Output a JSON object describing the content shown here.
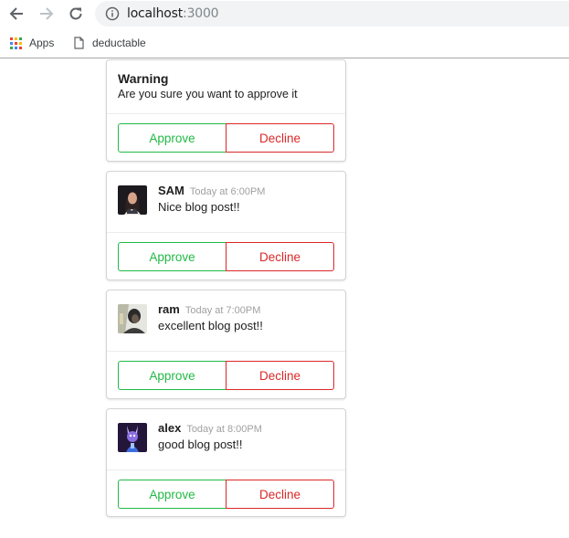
{
  "browser": {
    "url_host": "localhost",
    "url_port": ":3000",
    "bookmarks": [
      {
        "label": "Apps",
        "icon": "apps-grid-icon"
      },
      {
        "label": "deductable",
        "icon": "page-icon"
      }
    ]
  },
  "warning": {
    "title": "Warning",
    "message": "Are you sure you want to approve it",
    "approve_label": "Approve",
    "decline_label": "Decline"
  },
  "comments": [
    {
      "author": "SAM",
      "time": "Today at 6:00PM",
      "text": "Nice blog post!!",
      "approve_label": "Approve",
      "decline_label": "Decline"
    },
    {
      "author": "ram",
      "time": "Today at 7:00PM",
      "text": "excellent blog post!!",
      "approve_label": "Approve",
      "decline_label": "Decline"
    },
    {
      "author": "alex",
      "time": "Today at 8:00PM",
      "text": "good blog post!!",
      "approve_label": "Approve",
      "decline_label": "Decline"
    }
  ],
  "colors": {
    "approve": "#21ba45",
    "decline": "#db2828",
    "card_border": "#d4d4d5",
    "meta_text": "#a0a0a0"
  }
}
